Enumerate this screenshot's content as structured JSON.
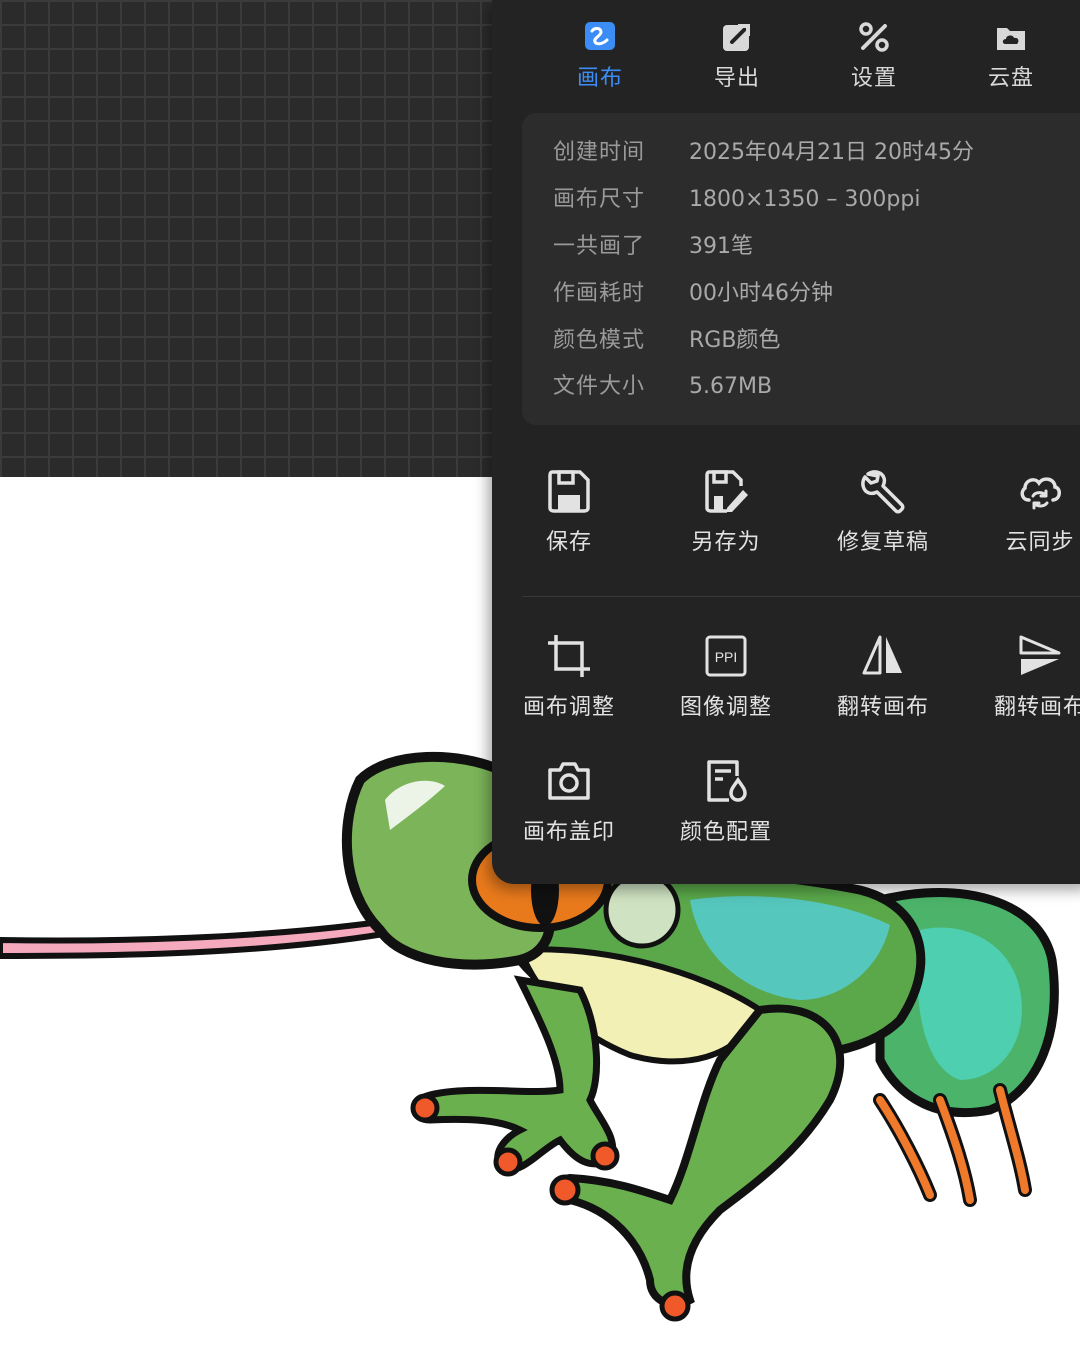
{
  "tabs": [
    {
      "label": "画布",
      "icon": "canvas-icon",
      "active": true
    },
    {
      "label": "导出",
      "icon": "export-icon",
      "active": false
    },
    {
      "label": "设置",
      "icon": "settings-icon",
      "active": false
    },
    {
      "label": "云盘",
      "icon": "cloud-drive-icon",
      "active": false
    }
  ],
  "info": [
    {
      "key": "创建时间",
      "value": "2025年04月21日 20时45分"
    },
    {
      "key": "画布尺寸",
      "value": "1800×1350 – 300ppi"
    },
    {
      "key": "一共画了",
      "value": "391笔"
    },
    {
      "key": "作画耗时",
      "value": "00小时46分钟"
    },
    {
      "key": "颜色模式",
      "value": "RGB颜色"
    },
    {
      "key": "文件大小",
      "value": "5.67MB"
    }
  ],
  "file_actions": [
    {
      "label": "保存",
      "icon": "save-icon"
    },
    {
      "label": "另存为",
      "icon": "save-as-icon"
    },
    {
      "label": "修复草稿",
      "icon": "wrench-icon"
    },
    {
      "label": "云同步",
      "icon": "cloud-sync-icon"
    }
  ],
  "canvas_actions": [
    {
      "label": "画布调整",
      "icon": "crop-icon"
    },
    {
      "label": "图像调整",
      "icon": "ppi-icon"
    },
    {
      "label": "翻转画布",
      "icon": "flip-horizontal-icon"
    },
    {
      "label": "翻转画布",
      "icon": "flip-vertical-icon"
    },
    {
      "label": "画布盖印",
      "icon": "camera-icon"
    },
    {
      "label": "颜色配置",
      "icon": "color-config-icon"
    }
  ],
  "colors": {
    "accent": "#3b8df5",
    "panel": "#232323",
    "card": "#2c2c2c",
    "grid_bg": "#2b2b2b"
  }
}
